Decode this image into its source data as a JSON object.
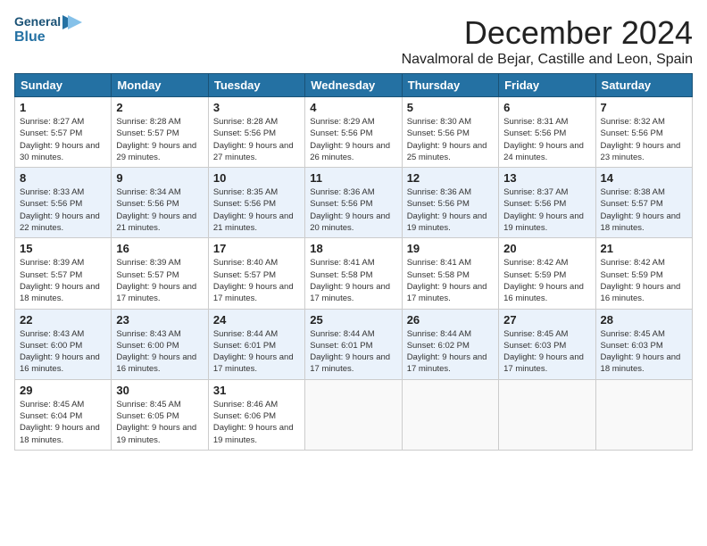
{
  "logo": {
    "general": "General",
    "blue": "Blue",
    "icon": "▶"
  },
  "header": {
    "month": "December 2024",
    "location": "Navalmoral de Bejar, Castille and Leon, Spain"
  },
  "weekdays": [
    "Sunday",
    "Monday",
    "Tuesday",
    "Wednesday",
    "Thursday",
    "Friday",
    "Saturday"
  ],
  "weeks": [
    [
      {
        "day": "1",
        "sunrise": "Sunrise: 8:27 AM",
        "sunset": "Sunset: 5:57 PM",
        "daylight": "Daylight: 9 hours and 30 minutes."
      },
      {
        "day": "2",
        "sunrise": "Sunrise: 8:28 AM",
        "sunset": "Sunset: 5:57 PM",
        "daylight": "Daylight: 9 hours and 29 minutes."
      },
      {
        "day": "3",
        "sunrise": "Sunrise: 8:28 AM",
        "sunset": "Sunset: 5:56 PM",
        "daylight": "Daylight: 9 hours and 27 minutes."
      },
      {
        "day": "4",
        "sunrise": "Sunrise: 8:29 AM",
        "sunset": "Sunset: 5:56 PM",
        "daylight": "Daylight: 9 hours and 26 minutes."
      },
      {
        "day": "5",
        "sunrise": "Sunrise: 8:30 AM",
        "sunset": "Sunset: 5:56 PM",
        "daylight": "Daylight: 9 hours and 25 minutes."
      },
      {
        "day": "6",
        "sunrise": "Sunrise: 8:31 AM",
        "sunset": "Sunset: 5:56 PM",
        "daylight": "Daylight: 9 hours and 24 minutes."
      },
      {
        "day": "7",
        "sunrise": "Sunrise: 8:32 AM",
        "sunset": "Sunset: 5:56 PM",
        "daylight": "Daylight: 9 hours and 23 minutes."
      }
    ],
    [
      {
        "day": "8",
        "sunrise": "Sunrise: 8:33 AM",
        "sunset": "Sunset: 5:56 PM",
        "daylight": "Daylight: 9 hours and 22 minutes."
      },
      {
        "day": "9",
        "sunrise": "Sunrise: 8:34 AM",
        "sunset": "Sunset: 5:56 PM",
        "daylight": "Daylight: 9 hours and 21 minutes."
      },
      {
        "day": "10",
        "sunrise": "Sunrise: 8:35 AM",
        "sunset": "Sunset: 5:56 PM",
        "daylight": "Daylight: 9 hours and 21 minutes."
      },
      {
        "day": "11",
        "sunrise": "Sunrise: 8:36 AM",
        "sunset": "Sunset: 5:56 PM",
        "daylight": "Daylight: 9 hours and 20 minutes."
      },
      {
        "day": "12",
        "sunrise": "Sunrise: 8:36 AM",
        "sunset": "Sunset: 5:56 PM",
        "daylight": "Daylight: 9 hours and 19 minutes."
      },
      {
        "day": "13",
        "sunrise": "Sunrise: 8:37 AM",
        "sunset": "Sunset: 5:56 PM",
        "daylight": "Daylight: 9 hours and 19 minutes."
      },
      {
        "day": "14",
        "sunrise": "Sunrise: 8:38 AM",
        "sunset": "Sunset: 5:57 PM",
        "daylight": "Daylight: 9 hours and 18 minutes."
      }
    ],
    [
      {
        "day": "15",
        "sunrise": "Sunrise: 8:39 AM",
        "sunset": "Sunset: 5:57 PM",
        "daylight": "Daylight: 9 hours and 18 minutes."
      },
      {
        "day": "16",
        "sunrise": "Sunrise: 8:39 AM",
        "sunset": "Sunset: 5:57 PM",
        "daylight": "Daylight: 9 hours and 17 minutes."
      },
      {
        "day": "17",
        "sunrise": "Sunrise: 8:40 AM",
        "sunset": "Sunset: 5:57 PM",
        "daylight": "Daylight: 9 hours and 17 minutes."
      },
      {
        "day": "18",
        "sunrise": "Sunrise: 8:41 AM",
        "sunset": "Sunset: 5:58 PM",
        "daylight": "Daylight: 9 hours and 17 minutes."
      },
      {
        "day": "19",
        "sunrise": "Sunrise: 8:41 AM",
        "sunset": "Sunset: 5:58 PM",
        "daylight": "Daylight: 9 hours and 17 minutes."
      },
      {
        "day": "20",
        "sunrise": "Sunrise: 8:42 AM",
        "sunset": "Sunset: 5:59 PM",
        "daylight": "Daylight: 9 hours and 16 minutes."
      },
      {
        "day": "21",
        "sunrise": "Sunrise: 8:42 AM",
        "sunset": "Sunset: 5:59 PM",
        "daylight": "Daylight: 9 hours and 16 minutes."
      }
    ],
    [
      {
        "day": "22",
        "sunrise": "Sunrise: 8:43 AM",
        "sunset": "Sunset: 6:00 PM",
        "daylight": "Daylight: 9 hours and 16 minutes."
      },
      {
        "day": "23",
        "sunrise": "Sunrise: 8:43 AM",
        "sunset": "Sunset: 6:00 PM",
        "daylight": "Daylight: 9 hours and 16 minutes."
      },
      {
        "day": "24",
        "sunrise": "Sunrise: 8:44 AM",
        "sunset": "Sunset: 6:01 PM",
        "daylight": "Daylight: 9 hours and 17 minutes."
      },
      {
        "day": "25",
        "sunrise": "Sunrise: 8:44 AM",
        "sunset": "Sunset: 6:01 PM",
        "daylight": "Daylight: 9 hours and 17 minutes."
      },
      {
        "day": "26",
        "sunrise": "Sunrise: 8:44 AM",
        "sunset": "Sunset: 6:02 PM",
        "daylight": "Daylight: 9 hours and 17 minutes."
      },
      {
        "day": "27",
        "sunrise": "Sunrise: 8:45 AM",
        "sunset": "Sunset: 6:03 PM",
        "daylight": "Daylight: 9 hours and 17 minutes."
      },
      {
        "day": "28",
        "sunrise": "Sunrise: 8:45 AM",
        "sunset": "Sunset: 6:03 PM",
        "daylight": "Daylight: 9 hours and 18 minutes."
      }
    ],
    [
      {
        "day": "29",
        "sunrise": "Sunrise: 8:45 AM",
        "sunset": "Sunset: 6:04 PM",
        "daylight": "Daylight: 9 hours and 18 minutes."
      },
      {
        "day": "30",
        "sunrise": "Sunrise: 8:45 AM",
        "sunset": "Sunset: 6:05 PM",
        "daylight": "Daylight: 9 hours and 19 minutes."
      },
      {
        "day": "31",
        "sunrise": "Sunrise: 8:46 AM",
        "sunset": "Sunset: 6:06 PM",
        "daylight": "Daylight: 9 hours and 19 minutes."
      },
      null,
      null,
      null,
      null
    ]
  ]
}
